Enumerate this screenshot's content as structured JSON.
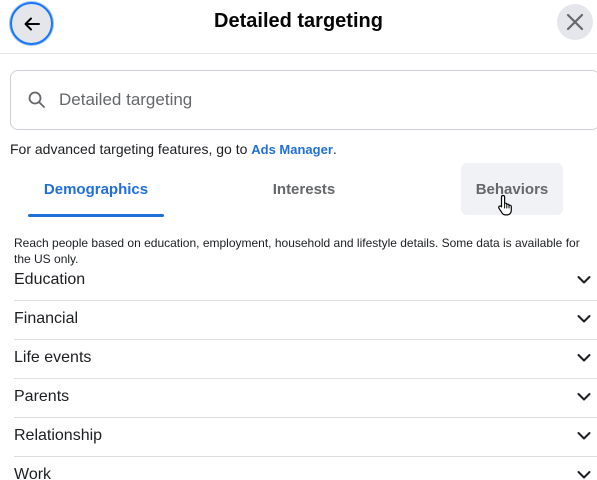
{
  "header": {
    "title": "Detailed targeting",
    "back_icon": "arrow-left-icon",
    "close_icon": "close-icon"
  },
  "search": {
    "placeholder": "Detailed targeting",
    "icon": "search-icon"
  },
  "advanced": {
    "prefix": "For advanced targeting features, go to ",
    "link_label": "Ads Manager",
    "suffix": "."
  },
  "tabs": [
    {
      "label": "Demographics",
      "active": true
    },
    {
      "label": "Interests",
      "active": false
    },
    {
      "label": "Behaviors",
      "active": false,
      "hovered": true
    }
  ],
  "description": "Reach people based on education, employment, household and lifestyle details. Some data is available for the US only.",
  "categories": [
    {
      "label": "Education"
    },
    {
      "label": "Financial"
    },
    {
      "label": "Life events"
    },
    {
      "label": "Parents"
    },
    {
      "label": "Relationship"
    },
    {
      "label": "Work"
    }
  ],
  "colors": {
    "accent": "#216fdb",
    "focus_ring": "#1877f2",
    "muted_text": "#65676b",
    "divider": "#dadde1"
  }
}
